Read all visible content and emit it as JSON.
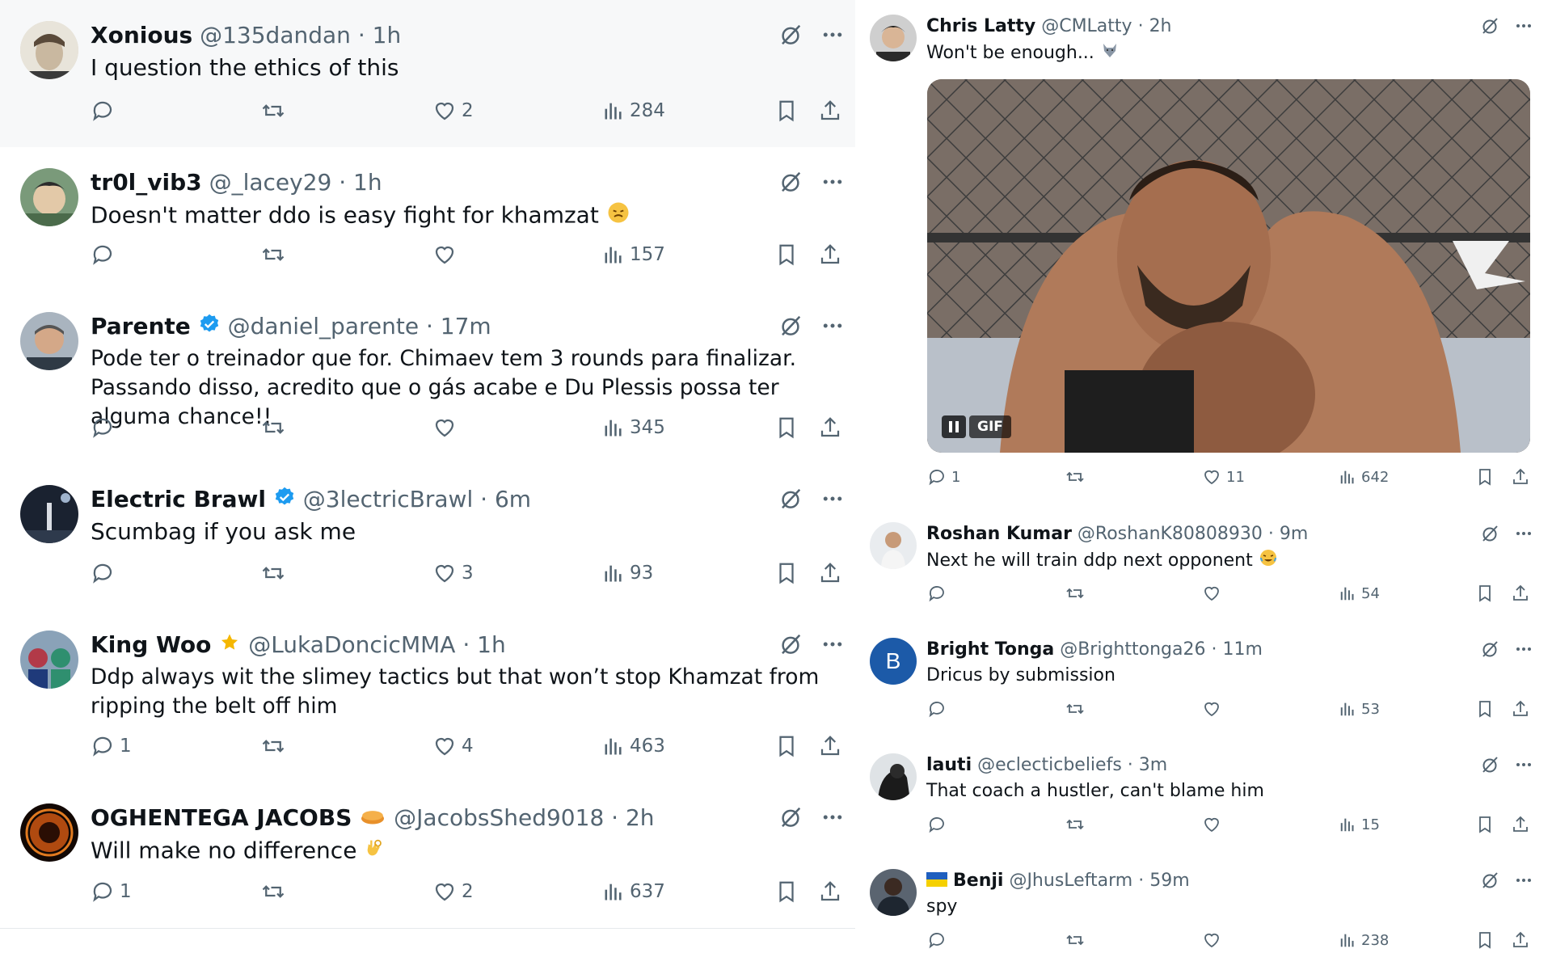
{
  "left_column": {
    "tweets": [
      {
        "name": "Xonious",
        "handle": "@135dandan",
        "time": "1h",
        "text": "I question the ethics of this",
        "replies": "",
        "likes": "2",
        "views": "284"
      },
      {
        "name": "tr0l_vib3",
        "handle": "@_lacey29",
        "time": "1h",
        "text": "Doesn't matter ddo is easy fight for khamzat",
        "replies": "",
        "likes": "",
        "views": "157"
      },
      {
        "name": "Parente",
        "handle": "@daniel_parente",
        "time": "17m",
        "text": "Pode ter o treinador que for. Chimaev tem 3 rounds para finalizar. Passando disso, acredito que o gás acabe e Du Plessis possa ter alguma chance!!",
        "replies": "",
        "likes": "",
        "views": "345"
      },
      {
        "name": "Electric Brawl",
        "handle": "@3lectricBrawl",
        "time": "6m",
        "text": "Scumbag if you ask me",
        "replies": "",
        "likes": "3",
        "views": "93"
      },
      {
        "name": "King Woo",
        "handle": "@LukaDoncicMMA",
        "time": "1h",
        "text": "Ddp always wit the slimey tactics but that won’t stop Khamzat from ripping the belt off him",
        "replies": "1",
        "likes": "4",
        "views": "463"
      },
      {
        "name": "OGHENTEGA JACOBS",
        "handle": "@JacobsShed9018",
        "time": "2h",
        "text": "Will make no difference",
        "replies": "1",
        "likes": "2",
        "views": "637"
      }
    ]
  },
  "right_column": {
    "tweets": [
      {
        "name": "Chris Latty",
        "handle": "@CMLatty",
        "time": "2h",
        "text": "Won't be enough...",
        "replies": "1",
        "likes": "11",
        "views": "642",
        "gif_label": "GIF"
      },
      {
        "name": "Roshan Kumar",
        "handle": "@RoshanK80808930",
        "time": "9m",
        "text": "Next he will train ddp next opponent",
        "replies": "",
        "likes": "",
        "views": "54"
      },
      {
        "name": "Bright Tonga",
        "handle": "@Brighttonga26",
        "time": "11m",
        "text": "Dricus by submission",
        "replies": "",
        "likes": "",
        "views": "53",
        "avatar_letter": "B"
      },
      {
        "name": "lauti",
        "handle": "@eclecticbeliefs",
        "time": "3m",
        "text": "That coach a hustler, can't blame him",
        "replies": "",
        "likes": "",
        "views": "15"
      },
      {
        "name": "Benji",
        "handle": "@JhusLeftarm",
        "time": "59m",
        "text": "spy",
        "replies": "",
        "likes": "",
        "views": "238"
      }
    ]
  },
  "icons": {
    "reply": "reply-icon",
    "retweet": "retweet-icon",
    "like": "heart-icon",
    "views": "views-icon",
    "bookmark": "bookmark-icon",
    "share": "share-icon",
    "grok": "grok-icon",
    "more": "more-icon",
    "verified": "verified-badge-icon"
  },
  "colors": {
    "text": "#0f1419",
    "secondary": "#536471",
    "verified": "#1d9bf0",
    "divider": "#e6e9ec"
  }
}
